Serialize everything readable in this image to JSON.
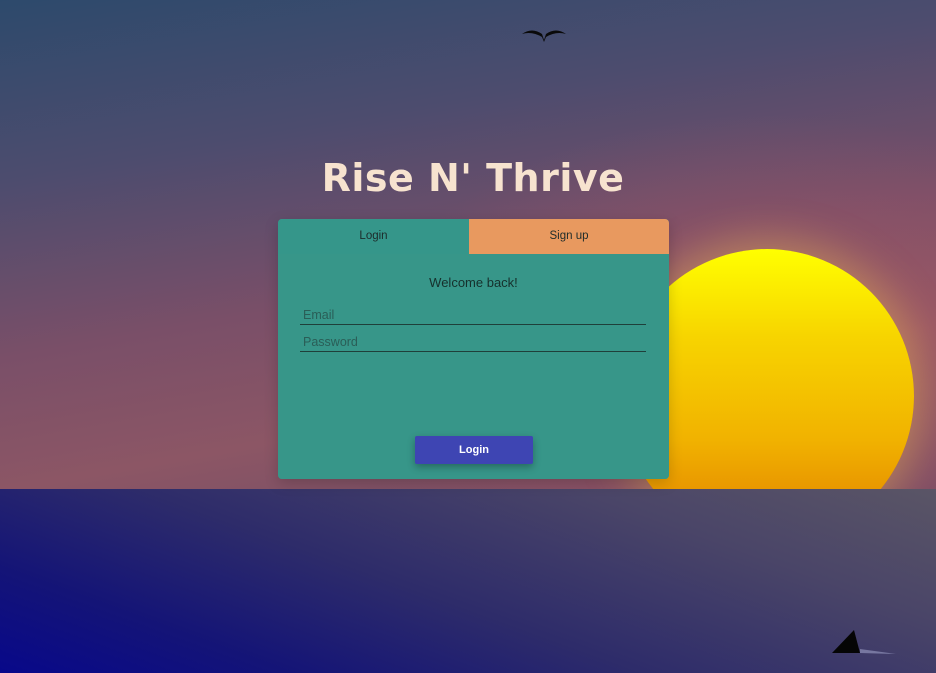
{
  "app": {
    "title": "Rise N' Thrive"
  },
  "tabs": [
    {
      "label": "Login",
      "active": true
    },
    {
      "label": "Sign up",
      "active": false
    }
  ],
  "login_form": {
    "heading": "Welcome back!",
    "email_placeholder": "Email",
    "email_value": "",
    "password_placeholder": "Password",
    "password_value": "",
    "submit_label": "Login"
  },
  "icons": {
    "bird": "bird-icon",
    "shark_fin": "shark-fin-icon"
  },
  "colors": {
    "title": "#f7e3cf",
    "card": "#379689",
    "tab_login": "#35968a",
    "tab_signup": "#e8995f",
    "button": "#3e45b3",
    "sun_top": "#ffff00",
    "sun_bottom": "#e07b00",
    "sea": "#141477"
  }
}
